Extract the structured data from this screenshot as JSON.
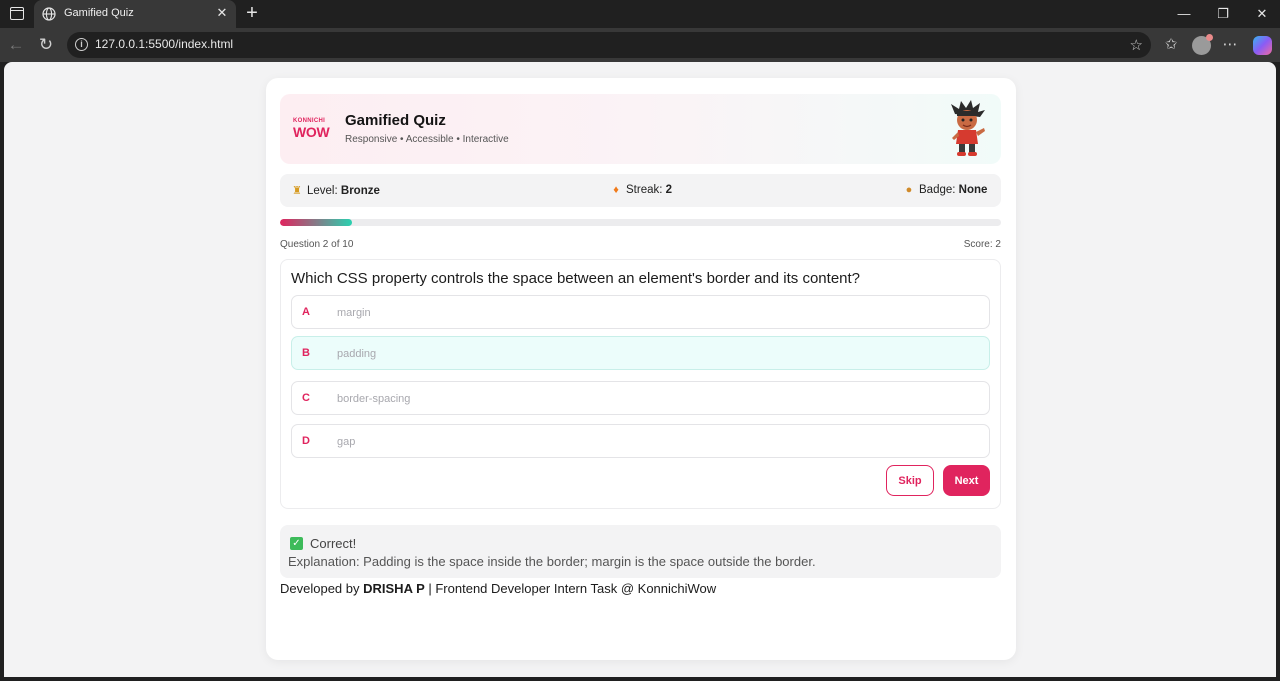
{
  "browser": {
    "tab_title": "Gamified Quiz",
    "url": "127.0.0.1:5500/index.html"
  },
  "header": {
    "logo_top": "KONNICHI",
    "logo_bottom": "WOW",
    "title": "Gamified Quiz",
    "subtitle": "Responsive • Accessible • Interactive"
  },
  "stats": {
    "level_label": "Level:",
    "level_value": "Bronze",
    "streak_label": "Streak:",
    "streak_value": "2",
    "badge_label": "Badge:",
    "badge_value": "None"
  },
  "progress": {
    "fraction": 0.1,
    "question_count": "Question 2 of 10",
    "score": "Score: 2"
  },
  "quiz": {
    "question": "Which CSS property controls the space between an element's border and its content?",
    "options": [
      {
        "letter": "A",
        "text": "margin"
      },
      {
        "letter": "B",
        "text": "padding"
      },
      {
        "letter": "C",
        "text": "border-spacing"
      },
      {
        "letter": "D",
        "text": "gap"
      }
    ],
    "selected_option": "B",
    "skip_label": "Skip",
    "next_label": "Next"
  },
  "feedback": {
    "title": "Correct!",
    "explanation": "Explanation: Padding is the space inside the border; margin is the space outside the border."
  },
  "footer": {
    "prefix": "Developed by ",
    "author": "DRISHA P",
    "suffix": " | Frontend Developer Intern Task @ KonnichiWow"
  },
  "colors": {
    "accent": "#e0245e",
    "teal": "#2ad1b0",
    "selected_bg": "#ecfdfb"
  }
}
